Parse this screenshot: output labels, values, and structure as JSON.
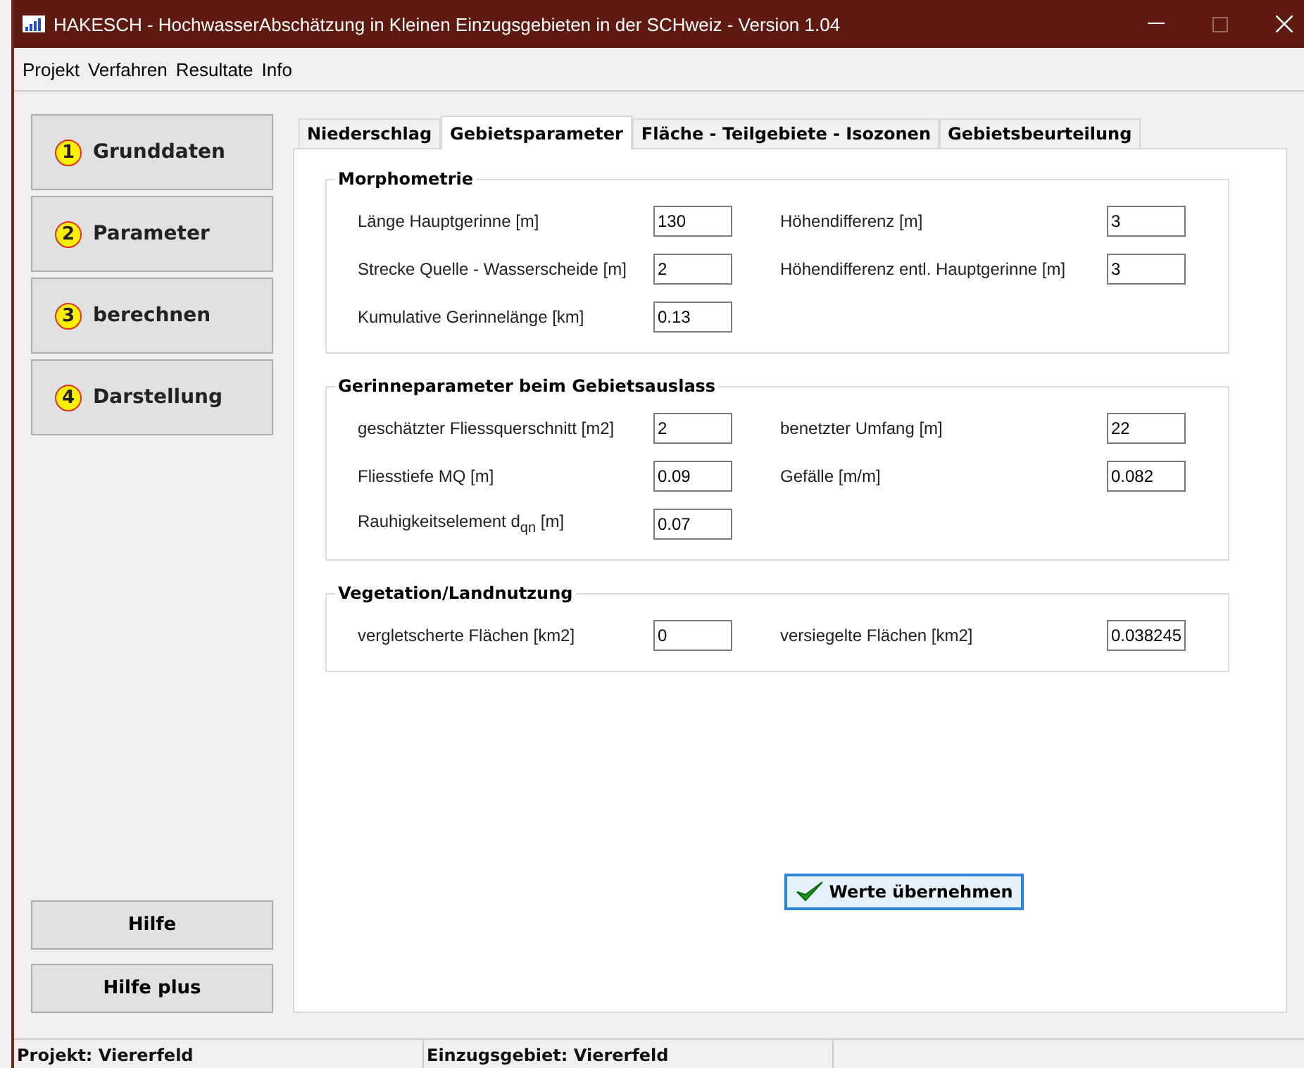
{
  "window": {
    "title": "HAKESCH - HochwasserAbschätzung in Kleinen Einzugsgebieten in der SCHweiz - Version 1.04"
  },
  "menu": [
    "Projekt",
    "Verfahren",
    "Resultate",
    "Info"
  ],
  "steps": [
    {
      "number": "1",
      "label": "Grunddaten"
    },
    {
      "number": "2",
      "label": "Parameter"
    },
    {
      "number": "3",
      "label": "berechnen"
    },
    {
      "number": "4",
      "label": "Darstellung"
    }
  ],
  "help_buttons": [
    "Hilfe",
    "Hilfe plus"
  ],
  "tabs": [
    {
      "label": "Niederschlag",
      "selected": false
    },
    {
      "label": "Gebietsparameter",
      "selected": true
    },
    {
      "label": "Fläche - Teilgebiete - Isozonen",
      "selected": false
    },
    {
      "label": "Gebietsbeurteilung",
      "selected": false
    }
  ],
  "groups": [
    {
      "title": "Morphometrie",
      "rows": [
        [
          {
            "label": "Länge Hauptgerinne [m]",
            "value": "130"
          },
          {
            "label": "Höhendifferenz [m]",
            "value": "3"
          }
        ],
        [
          {
            "label": "Strecke Quelle - Wasserscheide [m]",
            "value": "2"
          },
          {
            "label": "Höhendifferenz entl. Hauptgerinne [m]",
            "value": "3"
          }
        ],
        [
          {
            "label": "Kumulative Gerinnelänge [km]",
            "value": "0.13"
          }
        ]
      ]
    },
    {
      "title": "Gerinneparameter beim Gebietsauslass",
      "rows": [
        [
          {
            "label": "geschätzter Fliessquerschnitt [m2]",
            "value": "2"
          },
          {
            "label": "benetzter Umfang [m]",
            "value": "22"
          }
        ],
        [
          {
            "label": "Fliesstiefe MQ [m]",
            "value": "0.09"
          },
          {
            "label": "Gefälle [m/m]",
            "value": "0.082"
          }
        ],
        [
          {
            "label": "Rauhigkeitselement d$_{qn}$ [m]",
            "value": "0.07"
          }
        ]
      ]
    },
    {
      "title": "Vegetation/Landnutzung",
      "rows": [
        [
          {
            "label": "vergletscherte Flächen [km2]",
            "value": "0"
          },
          {
            "label": "versiegelte Flächen [km2]",
            "value": "0.038245"
          }
        ]
      ]
    }
  ],
  "apply_button": "Werte übernehmen",
  "status_bar": [
    "Projekt: Viererfeld",
    "Einzugsgebiet: Viererfeld"
  ]
}
